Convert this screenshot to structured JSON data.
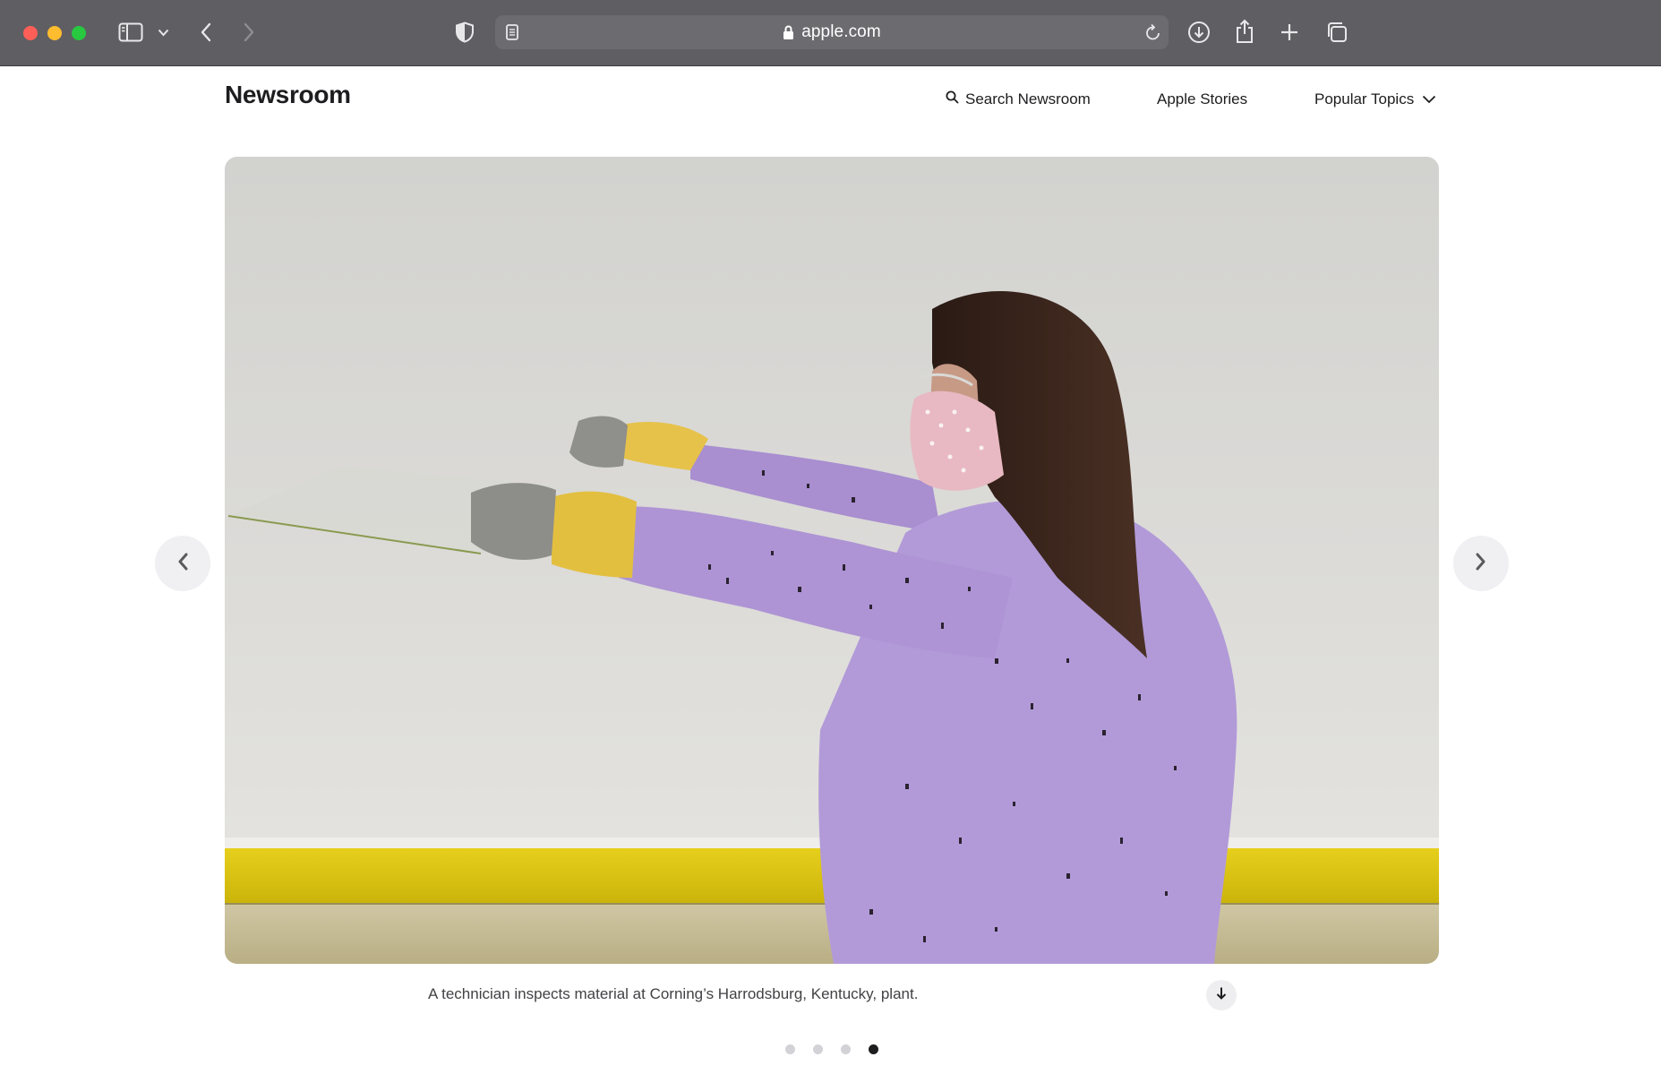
{
  "browser": {
    "url": "apple.com",
    "accent": "#5f5e63"
  },
  "header": {
    "brand": "Newsroom",
    "search_label": "Search Newsroom",
    "stories_label": "Apple Stories",
    "topics_label": "Popular Topics"
  },
  "gallery": {
    "caption": "A technician inspects material at Corning’s Harrodsburg, Kentucky, plant.",
    "slide_count": 4,
    "active_slide": 4
  },
  "icons": [
    "sidebar-icon",
    "chevron-down-icon",
    "back-icon",
    "forward-icon",
    "shield-icon",
    "reader-icon",
    "lock-icon",
    "reload-icon",
    "download-icon",
    "share-icon",
    "plus-icon",
    "tabs-icon",
    "search-icon",
    "arrow-left-icon",
    "arrow-right-icon",
    "arrow-down-icon"
  ]
}
